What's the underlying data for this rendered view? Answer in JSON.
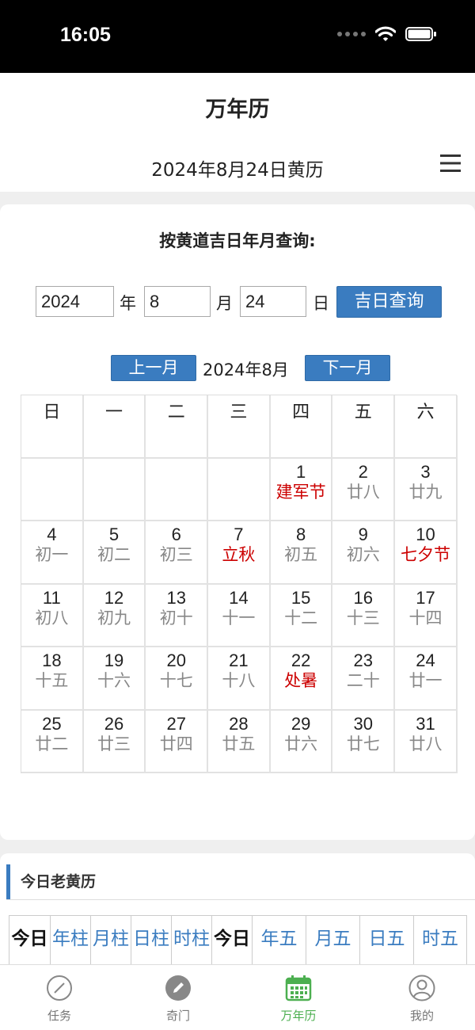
{
  "status_bar": {
    "time": "16:05"
  },
  "header": {
    "app_title": "万年历",
    "date_title": "2024年8月24日黄历"
  },
  "query": {
    "title": "按黄道吉日年月查询:",
    "year_value": "2024",
    "year_label": "年",
    "month_value": "8",
    "month_label": "月",
    "day_value": "24",
    "day_label": "日",
    "search_button": "吉日查询"
  },
  "month_nav": {
    "prev": "上一月",
    "current": "2024年8月",
    "next": "下一月"
  },
  "calendar": {
    "weekdays": [
      "日",
      "一",
      "二",
      "三",
      "四",
      "五",
      "六"
    ],
    "leading_blanks": 4,
    "days": [
      {
        "d": "1",
        "l": "建军节",
        "red": true
      },
      {
        "d": "2",
        "l": "廿八"
      },
      {
        "d": "3",
        "l": "廿九"
      },
      {
        "d": "4",
        "l": "初一"
      },
      {
        "d": "5",
        "l": "初二"
      },
      {
        "d": "6",
        "l": "初三"
      },
      {
        "d": "7",
        "l": "立秋",
        "red": true
      },
      {
        "d": "8",
        "l": "初五"
      },
      {
        "d": "9",
        "l": "初六"
      },
      {
        "d": "10",
        "l": "七夕节",
        "red": true
      },
      {
        "d": "11",
        "l": "初八"
      },
      {
        "d": "12",
        "l": "初九"
      },
      {
        "d": "13",
        "l": "初十"
      },
      {
        "d": "14",
        "l": "十一"
      },
      {
        "d": "15",
        "l": "十二"
      },
      {
        "d": "16",
        "l": "十三"
      },
      {
        "d": "17",
        "l": "十四"
      },
      {
        "d": "18",
        "l": "十五"
      },
      {
        "d": "19",
        "l": "十六"
      },
      {
        "d": "20",
        "l": "十七"
      },
      {
        "d": "21",
        "l": "十八"
      },
      {
        "d": "22",
        "l": "处暑",
        "red": true
      },
      {
        "d": "23",
        "l": "二十"
      },
      {
        "d": "24",
        "l": "廿一"
      },
      {
        "d": "25",
        "l": "廿二"
      },
      {
        "d": "26",
        "l": "廿三"
      },
      {
        "d": "27",
        "l": "廿四"
      },
      {
        "d": "28",
        "l": "廿五"
      },
      {
        "d": "29",
        "l": "廿六"
      },
      {
        "d": "30",
        "l": "廿七"
      },
      {
        "d": "31",
        "l": "廿八"
      }
    ]
  },
  "almanac": {
    "section_title": "今日老黄历",
    "cells": [
      {
        "t": "今日",
        "style": "black"
      },
      {
        "t": "年柱",
        "style": "blue"
      },
      {
        "t": "月柱",
        "style": "blue"
      },
      {
        "t": "日柱",
        "style": "blue"
      },
      {
        "t": "时柱",
        "style": "blue"
      },
      {
        "t": "今日",
        "style": "black"
      },
      {
        "t": "年五",
        "style": "blue"
      },
      {
        "t": "月五",
        "style": "blue"
      },
      {
        "t": "日五",
        "style": "blue"
      },
      {
        "t": "时五",
        "style": "blue"
      }
    ]
  },
  "tabs": [
    {
      "label": "任务",
      "icon": "compass-icon",
      "active": false
    },
    {
      "label": "奇门",
      "icon": "pen-icon",
      "active": false
    },
    {
      "label": "万年历",
      "icon": "calendar-icon",
      "active": true
    },
    {
      "label": "我的",
      "icon": "user-icon",
      "active": false
    }
  ],
  "colors": {
    "accent_blue": "#3a7cc0",
    "holiday_red": "#cc0000",
    "active_tab_green": "#4caf50"
  }
}
